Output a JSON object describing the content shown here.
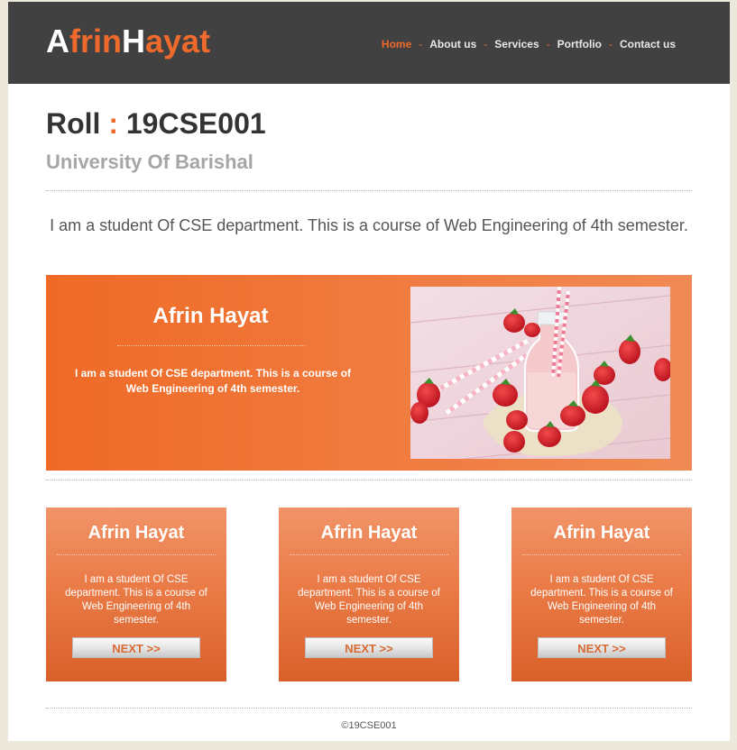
{
  "header": {
    "logo": {
      "part1": "A",
      "part2": "frin",
      "part3": "H",
      "part4": "ayat"
    },
    "nav": [
      {
        "label": "Home",
        "active": true
      },
      {
        "label": "About us",
        "active": false
      },
      {
        "label": "Services",
        "active": false
      },
      {
        "label": "Portfolio",
        "active": false
      },
      {
        "label": "Contact us",
        "active": false
      }
    ],
    "separator": "-"
  },
  "main": {
    "roll_label": "Roll",
    "roll_colon": ":",
    "roll_value": "19CSE001",
    "university": "University Of Barishal",
    "intro": "I am a student Of CSE department. This is a course of Web Engineering of 4th semester."
  },
  "banner": {
    "title": "Afrin Hayat",
    "text": "I am a student Of CSE department. This is a course of Web Engineering of 4th semester.",
    "image": "strawberry-milk-photo"
  },
  "cards": [
    {
      "title": "Afrin Hayat",
      "text": "I am a student Of CSE department. This is a course of Web Engineering of 4th semester.",
      "button": "NEXT >>"
    },
    {
      "title": "Afrin Hayat",
      "text": "I am a student Of CSE department. This is a course of Web Engineering of 4th semester.",
      "button": "NEXT >>"
    },
    {
      "title": "Afrin Hayat",
      "text": "I am a student Of CSE department. This is a course of Web Engineering of 4th semester.",
      "button": "NEXT >>"
    }
  ],
  "footer": {
    "text": "©19CSE001"
  },
  "colors": {
    "accent": "#ee6a2c",
    "header_bg": "#414141",
    "page_bg": "#ece9dc"
  }
}
